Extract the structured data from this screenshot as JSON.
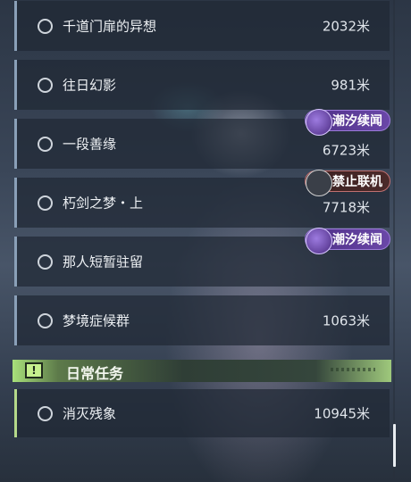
{
  "quests": [
    {
      "name": "千道门扉的异想",
      "distance": "2032米"
    },
    {
      "name": "往日幻影",
      "distance": "981米"
    },
    {
      "name": "一段善缘",
      "distance": "6723米",
      "badge": "潮汐续闻"
    },
    {
      "name": "朽剑之梦・上",
      "distance": "7718米",
      "badge": "禁止联机"
    },
    {
      "name": "那人短暂驻留",
      "distance": "",
      "badge": "潮汐续闻"
    },
    {
      "name": "梦境症候群",
      "distance": "1063米"
    }
  ],
  "daily_section": {
    "title": "日常任务",
    "icon": "!",
    "items": [
      {
        "name": "消灭残象",
        "distance": "10945米"
      }
    ]
  },
  "colors": {
    "quest_accent": "#8aa0b8",
    "daily_accent": "#b5d98a",
    "tide_badge": "#5b3a98",
    "ban_badge": "#4b2a2a"
  }
}
